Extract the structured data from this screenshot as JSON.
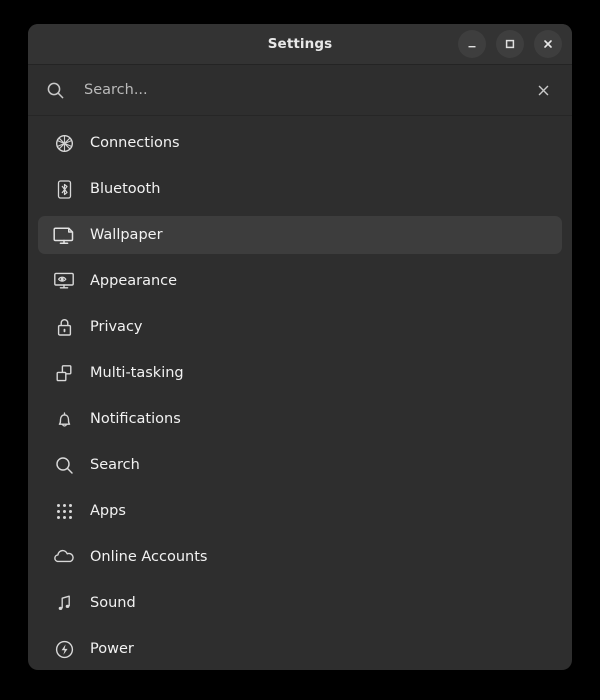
{
  "window": {
    "title": "Settings",
    "controls": [
      {
        "name": "minimize-button",
        "icon": "minimize-icon",
        "label": "Minimize"
      },
      {
        "name": "maximize-button",
        "icon": "maximize-icon",
        "label": "Maximize"
      },
      {
        "name": "close-button",
        "icon": "close-icon",
        "label": "Close"
      }
    ]
  },
  "search": {
    "icon": "search-icon",
    "placeholder": "Search...",
    "value": "",
    "clear_icon": "close-icon"
  },
  "sidebar": {
    "selected": "Wallpaper",
    "items": [
      {
        "label": "Connections",
        "icon": "globe-network-icon",
        "selected": false
      },
      {
        "label": "Bluetooth",
        "icon": "bluetooth-icon",
        "selected": false
      },
      {
        "label": "Wallpaper",
        "icon": "monitor-image-icon",
        "selected": true
      },
      {
        "label": "Appearance",
        "icon": "monitor-eye-icon",
        "selected": false
      },
      {
        "label": "Privacy",
        "icon": "lock-icon",
        "selected": false
      },
      {
        "label": "Multi-tasking",
        "icon": "windows-stack-icon",
        "selected": false
      },
      {
        "label": "Notifications",
        "icon": "bell-icon",
        "selected": false
      },
      {
        "label": "Search",
        "icon": "search-icon",
        "selected": false
      },
      {
        "label": "Apps",
        "icon": "grid-dots-icon",
        "selected": false
      },
      {
        "label": "Online Accounts",
        "icon": "cloud-icon",
        "selected": false
      },
      {
        "label": "Sound",
        "icon": "music-note-icon",
        "selected": false
      },
      {
        "label": "Power",
        "icon": "power-bolt-icon",
        "selected": false
      }
    ]
  },
  "colors": {
    "page_background": "#000000",
    "window_background": "#2e2e2e",
    "titlebar_background": "#333333",
    "selected_row": "#3d3d3d",
    "text": "#f2f2f2",
    "muted_text": "#b9b9b9"
  }
}
